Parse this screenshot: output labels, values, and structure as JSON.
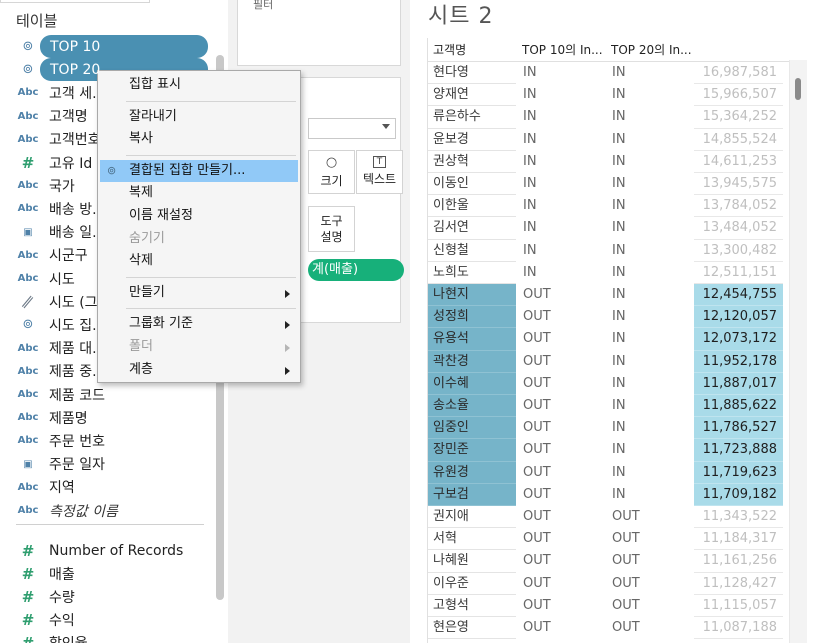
{
  "data_pane": {
    "title": "테이블",
    "fields": [
      {
        "label": "TOP 10",
        "icon": "set-icon",
        "type": "set",
        "selected": true
      },
      {
        "label": "TOP 20",
        "icon": "set-icon",
        "type": "set",
        "selected": true
      },
      {
        "label": "고객 세...",
        "icon": "abc-icon",
        "type": "string"
      },
      {
        "label": "고객명",
        "icon": "abc-icon",
        "type": "string"
      },
      {
        "label": "고객번호",
        "icon": "abc-icon",
        "type": "string"
      },
      {
        "label": "고유 Id",
        "icon": "hash-icon",
        "type": "number"
      },
      {
        "label": "국가",
        "icon": "abc-icon",
        "type": "string"
      },
      {
        "label": "배송 방...",
        "icon": "abc-icon",
        "type": "string"
      },
      {
        "label": "배송 일...",
        "icon": "calendar-icon",
        "type": "date"
      },
      {
        "label": "시군구",
        "icon": "abc-icon",
        "type": "string"
      },
      {
        "label": "시도",
        "icon": "abc-icon",
        "type": "string"
      },
      {
        "label": "시도 (그...",
        "icon": "paperclip-icon",
        "type": "group"
      },
      {
        "label": "시도 집...",
        "icon": "set-icon",
        "type": "set"
      },
      {
        "label": "제품 대...",
        "icon": "abc-icon",
        "type": "string"
      },
      {
        "label": "제품 중...",
        "icon": "abc-icon",
        "type": "string"
      },
      {
        "label": "제품 코드",
        "icon": "abc-icon",
        "type": "string"
      },
      {
        "label": "제품명",
        "icon": "abc-icon",
        "type": "string"
      },
      {
        "label": "주문 번호",
        "icon": "abc-icon",
        "type": "string"
      },
      {
        "label": "주문 일자",
        "icon": "calendar-icon",
        "type": "date"
      },
      {
        "label": "지역",
        "icon": "abc-icon",
        "type": "string"
      },
      {
        "label": "측정값 이름",
        "icon": "abc-icon",
        "type": "string",
        "italic": true
      }
    ],
    "measures": [
      {
        "label": "Number of Records",
        "icon": "hash-icon"
      },
      {
        "label": "매출",
        "icon": "hash-icon"
      },
      {
        "label": "수량",
        "icon": "hash-icon"
      },
      {
        "label": "수익",
        "icon": "hash-icon"
      },
      {
        "label": "할인율",
        "icon": "hash-icon"
      }
    ]
  },
  "shelves": {
    "filters_label": "필터",
    "marks": {
      "size_label": "크기",
      "label_label": "텍스트",
      "tooltip_label_line1": "도구",
      "tooltip_label_line2": "설명",
      "measure_pill": "계(매출)"
    }
  },
  "context_menu": {
    "items": [
      {
        "label": "집합 표시"
      },
      {
        "separator": true
      },
      {
        "label": "잘라내기"
      },
      {
        "label": "복사"
      },
      {
        "separator": true
      },
      {
        "label": "결합된 집합 만들기...",
        "active": true,
        "icon": "combine-set-icon"
      },
      {
        "label": "복제"
      },
      {
        "label": "이름 재설정"
      },
      {
        "label": "숨기기",
        "disabled": true
      },
      {
        "label": "삭제"
      },
      {
        "separator": true
      },
      {
        "label": "만들기",
        "submenu": true
      },
      {
        "separator": true
      },
      {
        "label": "그룹화 기준",
        "submenu": true
      },
      {
        "label": "폴더",
        "submenu": true,
        "disabled": true
      },
      {
        "label": "계층",
        "submenu": true
      }
    ]
  },
  "sheet": {
    "title": "시트 2",
    "columns": [
      "고객명",
      "TOP 10의 In...",
      "TOP 20의 In..."
    ],
    "rows": [
      {
        "name": "현다영",
        "top10": "IN",
        "top20": "IN",
        "value": "16,987,581",
        "highlight": false
      },
      {
        "name": "양재연",
        "top10": "IN",
        "top20": "IN",
        "value": "15,966,507",
        "highlight": false
      },
      {
        "name": "류은하수",
        "top10": "IN",
        "top20": "IN",
        "value": "15,364,252",
        "highlight": false
      },
      {
        "name": "윤보경",
        "top10": "IN",
        "top20": "IN",
        "value": "14,855,524",
        "highlight": false
      },
      {
        "name": "권상혁",
        "top10": "IN",
        "top20": "IN",
        "value": "14,611,253",
        "highlight": false
      },
      {
        "name": "이동인",
        "top10": "IN",
        "top20": "IN",
        "value": "13,945,575",
        "highlight": false
      },
      {
        "name": "이한울",
        "top10": "IN",
        "top20": "IN",
        "value": "13,784,052",
        "highlight": false
      },
      {
        "name": "김서연",
        "top10": "IN",
        "top20": "IN",
        "value": "13,484,052",
        "highlight": false
      },
      {
        "name": "신형철",
        "top10": "IN",
        "top20": "IN",
        "value": "13,300,482",
        "highlight": false
      },
      {
        "name": "노희도",
        "top10": "IN",
        "top20": "IN",
        "value": "12,511,151",
        "highlight": false
      },
      {
        "name": "나현지",
        "top10": "OUT",
        "top20": "IN",
        "value": "12,454,755",
        "highlight": true
      },
      {
        "name": "성정희",
        "top10": "OUT",
        "top20": "IN",
        "value": "12,120,057",
        "highlight": true
      },
      {
        "name": "유용석",
        "top10": "OUT",
        "top20": "IN",
        "value": "12,073,172",
        "highlight": true
      },
      {
        "name": "곽찬경",
        "top10": "OUT",
        "top20": "IN",
        "value": "11,952,178",
        "highlight": true
      },
      {
        "name": "이수혜",
        "top10": "OUT",
        "top20": "IN",
        "value": "11,887,017",
        "highlight": true
      },
      {
        "name": "송소율",
        "top10": "OUT",
        "top20": "IN",
        "value": "11,885,622",
        "highlight": true
      },
      {
        "name": "임중인",
        "top10": "OUT",
        "top20": "IN",
        "value": "11,786,527",
        "highlight": true
      },
      {
        "name": "장민준",
        "top10": "OUT",
        "top20": "IN",
        "value": "11,723,888",
        "highlight": true
      },
      {
        "name": "유원경",
        "top10": "OUT",
        "top20": "IN",
        "value": "11,719,623",
        "highlight": true
      },
      {
        "name": "구보검",
        "top10": "OUT",
        "top20": "IN",
        "value": "11,709,182",
        "highlight": true
      },
      {
        "name": "권지애",
        "top10": "OUT",
        "top20": "OUT",
        "value": "11,343,522",
        "highlight": false
      },
      {
        "name": "서혁",
        "top10": "OUT",
        "top20": "OUT",
        "value": "11,184,317",
        "highlight": false
      },
      {
        "name": "나혜원",
        "top10": "OUT",
        "top20": "OUT",
        "value": "11,161,256",
        "highlight": false
      },
      {
        "name": "이우준",
        "top10": "OUT",
        "top20": "OUT",
        "value": "11,128,427",
        "highlight": false
      },
      {
        "name": "고형석",
        "top10": "OUT",
        "top20": "OUT",
        "value": "11,115,057",
        "highlight": false
      },
      {
        "name": "현은영",
        "top10": "OUT",
        "top20": "OUT",
        "value": "11,087,188",
        "highlight": false
      }
    ]
  },
  "colors": {
    "set_pill": "#4a90b2",
    "measure_pill": "#17b07a",
    "highlight_name": "#76b4c9",
    "highlight_value": "#a9dbe9",
    "menu_active": "#91c9f7"
  }
}
